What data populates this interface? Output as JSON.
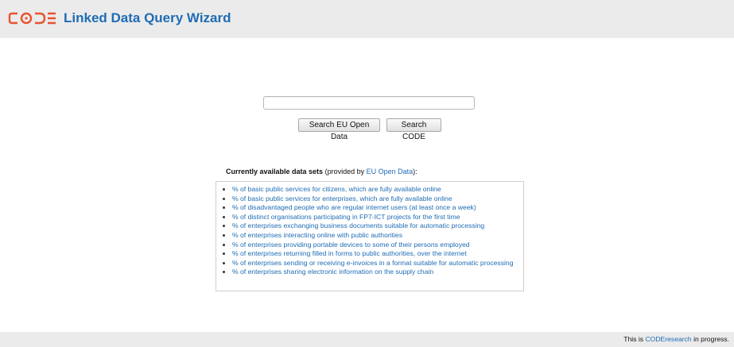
{
  "header": {
    "logo_text": "CODE",
    "title": "Linked Data Query Wizard"
  },
  "search": {
    "value": "",
    "placeholder": "",
    "eu_button_label": "Search EU Open Data",
    "code_button_label": "Search CODE"
  },
  "datasets": {
    "heading": "Currently available data sets",
    "provided_prefix": "(provided by ",
    "provider_link": "EU Open Data",
    "provided_suffix": "):",
    "items": [
      "% of basic public services for citizens, which are fully available online",
      "% of basic public services for enterprises, which are fully available online",
      "% of disadvantaged people who are regular internet users (at least once a week)",
      "% of distinct organisations participating in FP7-ICT projects for the first time",
      "% of enterprises exchanging business documents suitable for automatic processing",
      "% of enterprises interacting online with public authorities",
      "% of enterprises providing portable devices to some of their persons employed",
      "% of enterprises returning filled in forms to public authorities, over the internet",
      "% of enterprises sending or receiving e-invoices in a format suitable for automatic processing",
      "% of enterprises sharing electronic information on the supply chain"
    ]
  },
  "footer": {
    "prefix": "This is ",
    "link": "CODEresearch",
    "suffix": " in progress."
  },
  "colors": {
    "logo": "#e8532f",
    "title": "#1f6cb5",
    "link": "#1f6cb5",
    "band": "#ebebeb"
  }
}
